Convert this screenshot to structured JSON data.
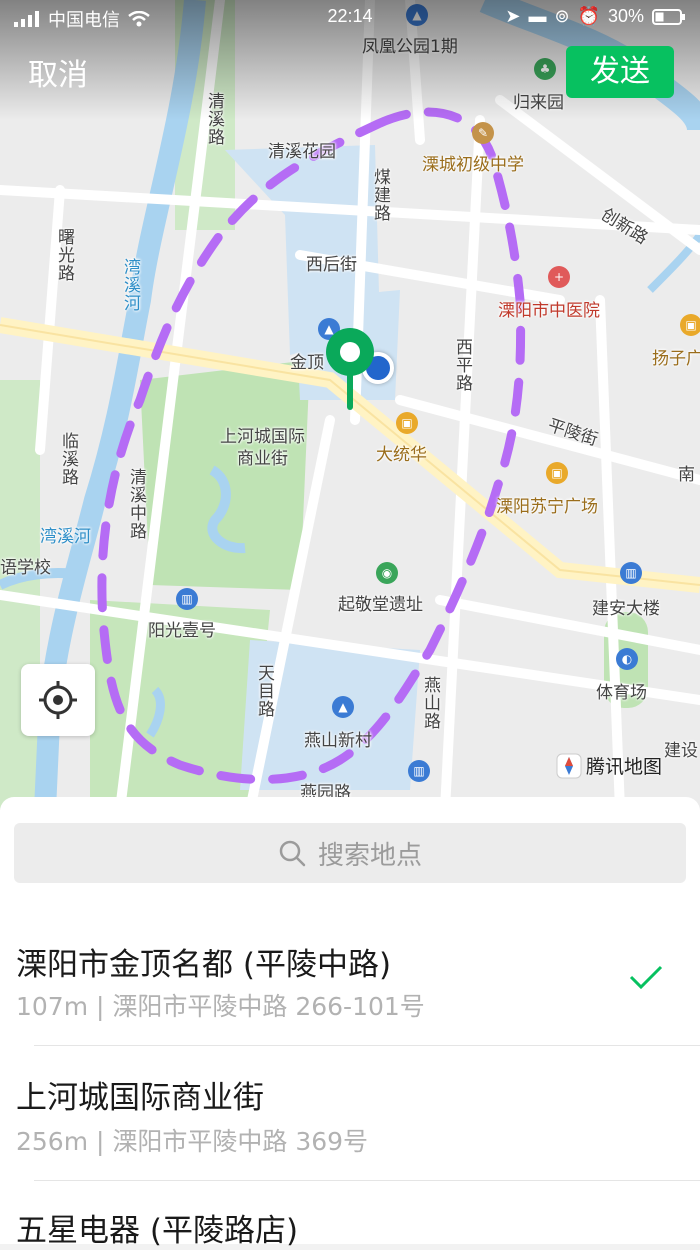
{
  "status_bar": {
    "carrier": "中国电信",
    "time": "22:14",
    "battery": "30%"
  },
  "nav": {
    "cancel_label": "取消",
    "send_label": "发送"
  },
  "map": {
    "attribution": "腾讯地图",
    "labels": {
      "fenghuang": "凤凰公园1期",
      "guilaiyuan": "归来园",
      "qingxi_huayuan": "清溪花园",
      "chuji_zhongxue": "溧城初级中学",
      "meijian_lu": "煤建路",
      "qingxi_lu": "清溪路",
      "chuangxin_lu": "创新路",
      "shuguang_lu": "曙光路",
      "wanxi_he_v": "湾溪河",
      "xihou_jie": "西后街",
      "zhongyiyuan": "溧阳市中医院",
      "jinding": "金顶",
      "xiping_lu": "西平路",
      "yangzi": "扬子广",
      "pingling_jie": "平陵街",
      "shanghecheng": "上河城国际\n商业街",
      "datonghua": "大统华",
      "linxi_lu": "临溪路",
      "qingxi_zhonglu": "清溪中路",
      "suning": "溧阳苏宁广场",
      "nan": "南",
      "wanxi_he_h": "湾溪河",
      "yuxuexiao": "语学校",
      "qijingtang": "起敬堂遗址",
      "yangguang": "阳光壹号",
      "jianan": "建安大楼",
      "tianmu_lu": "天目路",
      "yanshan_lu": "燕山路",
      "tiyuchang": "体育场",
      "yanshan_xincun": "燕山新村",
      "jianshe": "建设",
      "yanyuan_lu": "燕园路"
    }
  },
  "search": {
    "placeholder": "搜索地点"
  },
  "results": [
    {
      "name": "溧阳市金顶名都 (平陵中路)",
      "address": "107m | 溧阳市平陵中路 266-101号",
      "selected": true
    },
    {
      "name": "上河城国际商业街",
      "address": "256m | 溧阳市平陵中路 369号",
      "selected": false
    },
    {
      "name": "五星电器 (平陵路店)",
      "address": "",
      "selected": false
    }
  ],
  "colors": {
    "accent": "#07c160",
    "route": "#b56cf5",
    "pin": "#0aa95a",
    "user_dot": "#2266cc"
  }
}
